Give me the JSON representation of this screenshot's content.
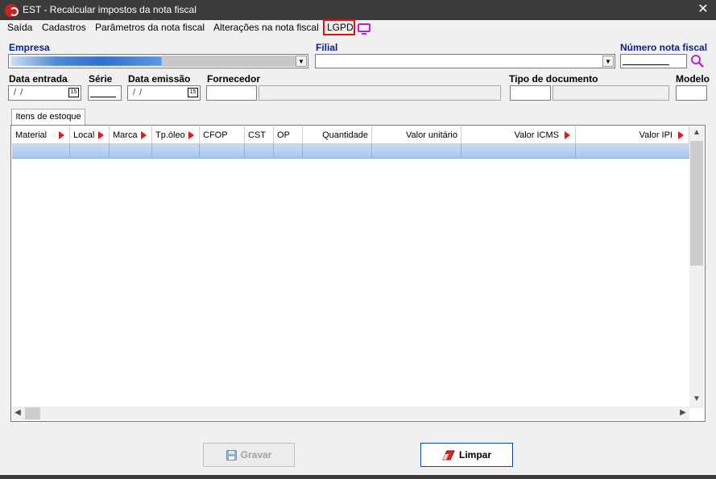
{
  "window": {
    "title": "EST - Recalcular impostos da nota fiscal"
  },
  "menu": {
    "items": [
      "Saída",
      "Cadastros",
      "Parâmetros da nota fiscal",
      "Alterações na nota fiscal",
      "LGPD"
    ]
  },
  "form": {
    "empresa_label": "Empresa",
    "filial_label": "Filial",
    "numero_nota_label": "Número nota fiscal",
    "data_entrada_label": "Data entrada",
    "serie_label": "Série",
    "data_emissao_label": "Data emissão",
    "fornecedor_label": "Fornecedor",
    "tipo_documento_label": "Tipo de documento",
    "modelo_label": "Modelo",
    "date_placeholder": "/ /",
    "calendar_day": "15"
  },
  "tabs": [
    "Itens de estoque"
  ],
  "grid": {
    "columns": [
      "Material",
      "Local",
      "Marca",
      "Tp.óleo",
      "CFOP",
      "CST",
      "OP",
      "Quantidade",
      "Valor unitário",
      "Valor ICMS",
      "Valor IPI"
    ]
  },
  "buttons": {
    "save": "Gravar",
    "clear": "Limpar"
  },
  "colors": {
    "titlebar": "#3b3b3b",
    "label_navy": "#0c1e8a",
    "highlight_red": "#e01010",
    "monitor_purple": "#b126d6",
    "selected_row": "#a9c6ee"
  }
}
